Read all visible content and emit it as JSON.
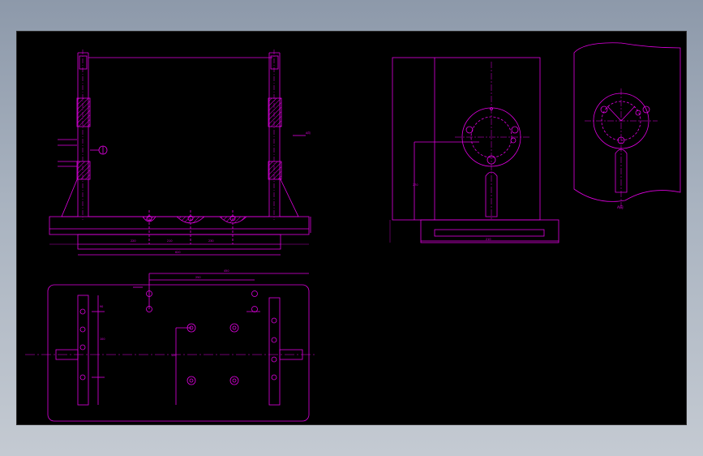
{
  "theme": {
    "background": "#000000",
    "line_color": "#e000e0",
    "frame_gradient_top": "#8d99aa",
    "frame_gradient_bottom": "#c4cad2"
  },
  "drawing": {
    "front_view": {
      "side_label": "A向",
      "dimension_labels": [
        "220",
        "210",
        "230",
        "620"
      ]
    },
    "top_view": {
      "dimension_labels": [
        "450",
        "250",
        "120",
        "90",
        "100"
      ]
    },
    "side_view": {
      "dimension_labels": [
        "270",
        "210"
      ]
    },
    "detail_view": {
      "label": "A向"
    }
  }
}
